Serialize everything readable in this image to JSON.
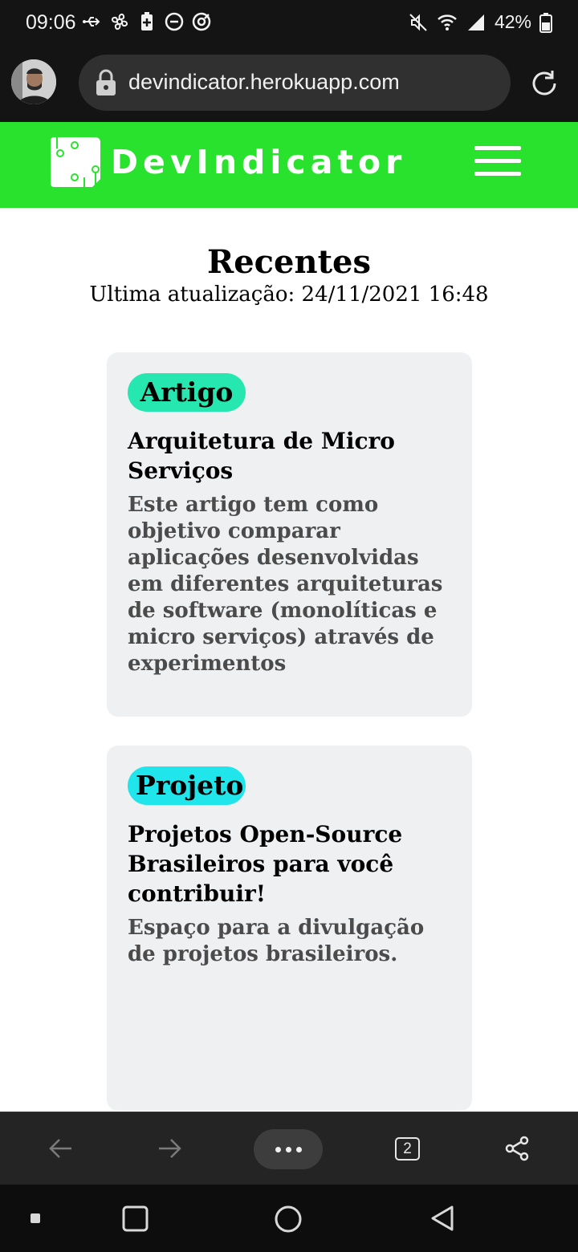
{
  "status_bar": {
    "time": "09:06",
    "battery": "42%"
  },
  "browser": {
    "url": "devindicator.herokuapp.com",
    "tab_count": "2"
  },
  "site": {
    "brand": "DevIndicator",
    "accent_color": "#29e22d"
  },
  "main": {
    "title": "Recentes",
    "last_update": "Ultima atualização: 24/11/2021 16:48"
  },
  "cards": [
    {
      "badge": "Artigo",
      "badge_color": "#27e7b0",
      "title": "Arquitetura de Micro Serviços",
      "description": "Este artigo tem como objetivo comparar aplicações desenvolvidas em diferentes arquiteturas de software (monolíticas e micro serviços) através de experimentos"
    },
    {
      "badge": "Projeto",
      "badge_color": "#20e5ea",
      "title": "Projetos Open-Source Brasileiros para você contribuir!",
      "description": "Espaço para a divulgação de projetos brasileiros."
    }
  ],
  "icons": {
    "status_left": [
      "usb-icon",
      "fan-icon",
      "battery-saver-icon",
      "do-not-disturb-icon",
      "data-saver-icon"
    ],
    "status_right": [
      "mute-icon",
      "wifi-icon",
      "signal-icon",
      "battery-icon"
    ],
    "toolbar": [
      "back-arrow-icon",
      "forward-arrow-icon",
      "more-icon",
      "tab-switcher-icon",
      "share-icon"
    ],
    "android_nav": [
      "recents-dot-icon",
      "overview-icon",
      "home-icon",
      "back-icon"
    ]
  }
}
